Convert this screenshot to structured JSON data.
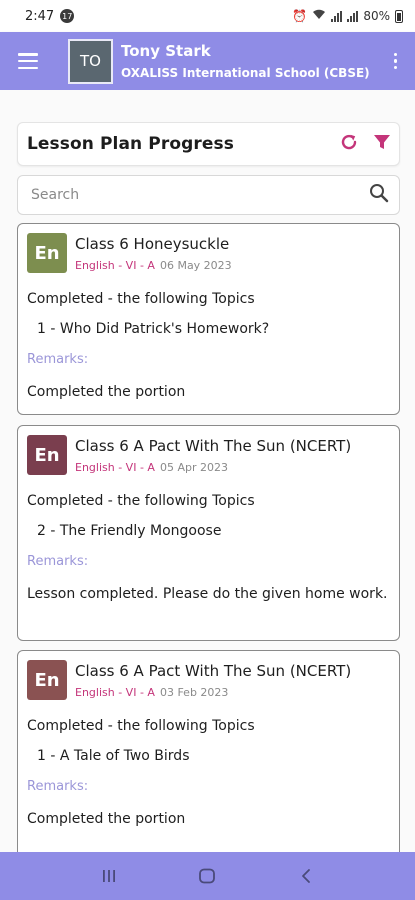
{
  "status_bar": {
    "time": "2:47",
    "notif_count": "17",
    "battery": "80%"
  },
  "app_bar": {
    "avatar_initials": "TO",
    "user_name": "Tony Stark",
    "school": "OXALISS International School (CBSE)"
  },
  "colors": {
    "primary": "#8f8ce6",
    "accent": "#c4357a",
    "remarks": "#9b96d8"
  },
  "header": {
    "title": "Lesson Plan Progress"
  },
  "search": {
    "placeholder": "Search"
  },
  "lessons": [
    {
      "icon": "En",
      "icon_color": "#7d8e4f",
      "class_name": "Class 6 Honeysuckle",
      "subject": "English - VI - A",
      "date": "06 May 2023",
      "completed_label": "Completed - the following Topics",
      "topic": "1 - Who Did Patrick's Homework?",
      "remarks_label": "Remarks:",
      "remarks": "Completed the portion"
    },
    {
      "icon": "En",
      "icon_color": "#7a3e4e",
      "class_name": "Class 6 A Pact With The Sun (NCERT)",
      "subject": "English - VI - A",
      "date": "05 Apr 2023",
      "completed_label": "Completed - the following Topics",
      "topic": "2 - The Friendly Mongoose",
      "remarks_label": "Remarks:",
      "remarks": "Lesson completed. Please do the given home work."
    },
    {
      "icon": "En",
      "icon_color": "#8a5252",
      "class_name": "Class 6 A Pact With The Sun (NCERT)",
      "subject": "English - VI - A",
      "date": "03 Feb 2023",
      "completed_label": "Completed - the following Topics",
      "topic": "1 - A Tale of Two Birds",
      "remarks_label": "Remarks:",
      "remarks": "Completed the portion"
    }
  ]
}
